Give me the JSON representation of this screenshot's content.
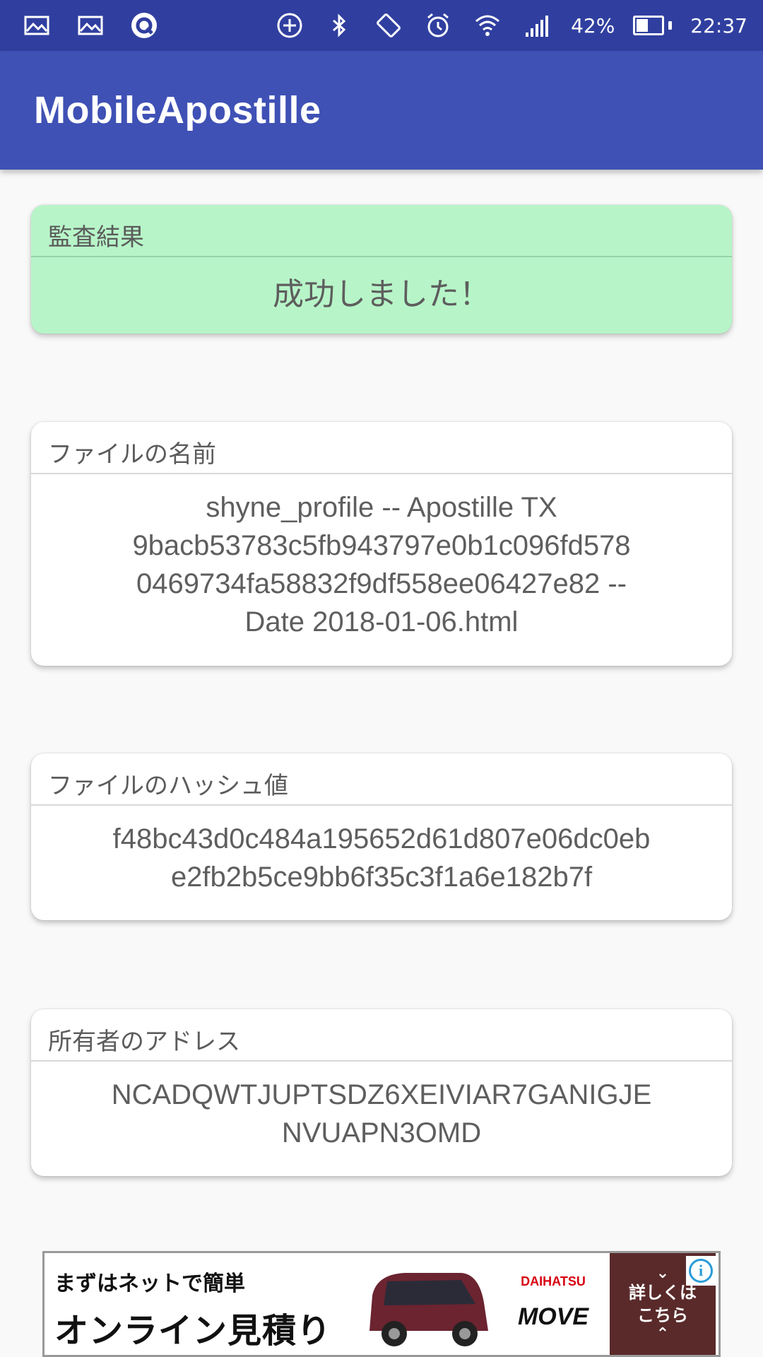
{
  "status_bar": {
    "left_icons": [
      "image-icon",
      "image-icon",
      "q-app-icon"
    ],
    "right_icons": [
      "add-circle-icon",
      "bluetooth-icon",
      "rotate-icon",
      "alarm-icon",
      "wifi-icon",
      "signal-icon"
    ],
    "battery_percent": "42%",
    "battery_level": 0.42,
    "time": "22:37",
    "color": "#303f9f"
  },
  "app_bar": {
    "title": "MobileApostille",
    "color": "#3f51b5"
  },
  "cards": {
    "result": {
      "label": "監査結果",
      "value": "成功しました！",
      "background": "#b7f5c8"
    },
    "filename": {
      "label": "ファイルの名前",
      "value": "shyne_profile -- Apostille TX\n9bacb53783c5fb943797e0b1c096fd578\n0469734fa58832f9df558ee06427e82 --\nDate 2018-01-06.html"
    },
    "hash": {
      "label": "ファイルのハッシュ値",
      "value": "f48bc43d0c484a195652d61d807e06dc0eb\ne2fb2b5ce9bb6f35c3f1a6e182b7f"
    },
    "owner": {
      "label": "所有者のアドレス",
      "value": "NCADQWTJUPTSDZ6XEIVIAR7GANIGJE\nNVUAPN3OMD"
    }
  },
  "ad": {
    "line1": "まずはネットで簡単",
    "line2": "オンライン見積り",
    "brand": "DAIHATSU",
    "model": "MOVE",
    "cta_line1": "詳しくは",
    "cta_line2": "こちら",
    "info_icon": "i"
  }
}
